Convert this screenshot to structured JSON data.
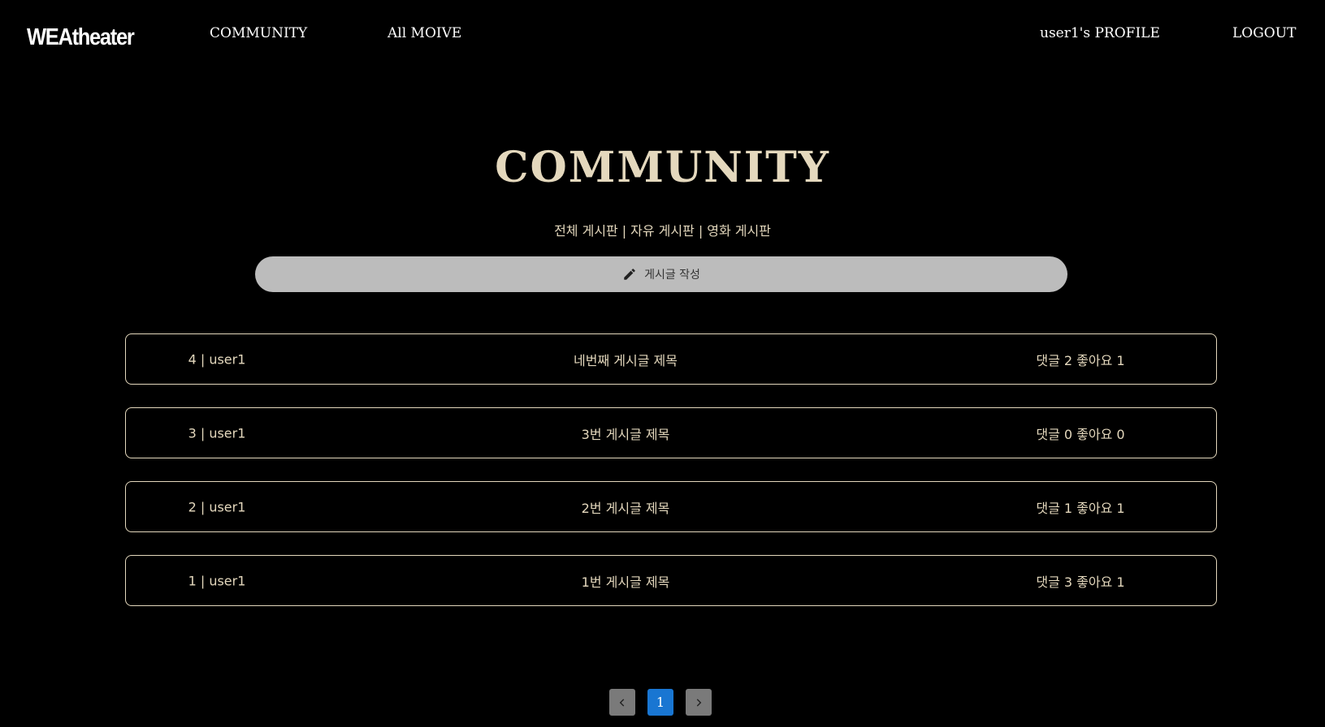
{
  "nav": {
    "logo": "WEAtheater",
    "community": "COMMUNITY",
    "all_movies": "All MOIVE",
    "profile": "user1's PROFILE",
    "logout": "LOGOUT"
  },
  "main": {
    "title": "COMMUNITY",
    "filters": [
      "전체 게시판",
      "자유 게시판",
      "영화 게시판"
    ],
    "separator": "|",
    "write_button": {
      "label": "게시글 작성",
      "icon": "pencil-icon"
    }
  },
  "posts": [
    {
      "author": "4 | user1",
      "title": "네번째 게시글 제목",
      "stats": "댓글 2 좋아요 1"
    },
    {
      "author": "3 | user1",
      "title": "3번 게시글 제목",
      "stats": "댓글 0 좋아요 0"
    },
    {
      "author": "2 | user1",
      "title": "2번 게시글 제목",
      "stats": "댓글 1 좋아요 1"
    },
    {
      "author": "1 | user1",
      "title": "1번 게시글 제목",
      "stats": "댓글 3 좋아요 1"
    }
  ],
  "pagination": {
    "current_page": "1",
    "prev_icon": "chevron-left-icon",
    "next_icon": "chevron-right-icon"
  },
  "colors": {
    "background": "#000000",
    "accent_beige": "#e4d8bd",
    "write_button_bg": "#bcbcbc",
    "page_current": "#1976d2",
    "page_arrow": "#7a7a7a"
  }
}
